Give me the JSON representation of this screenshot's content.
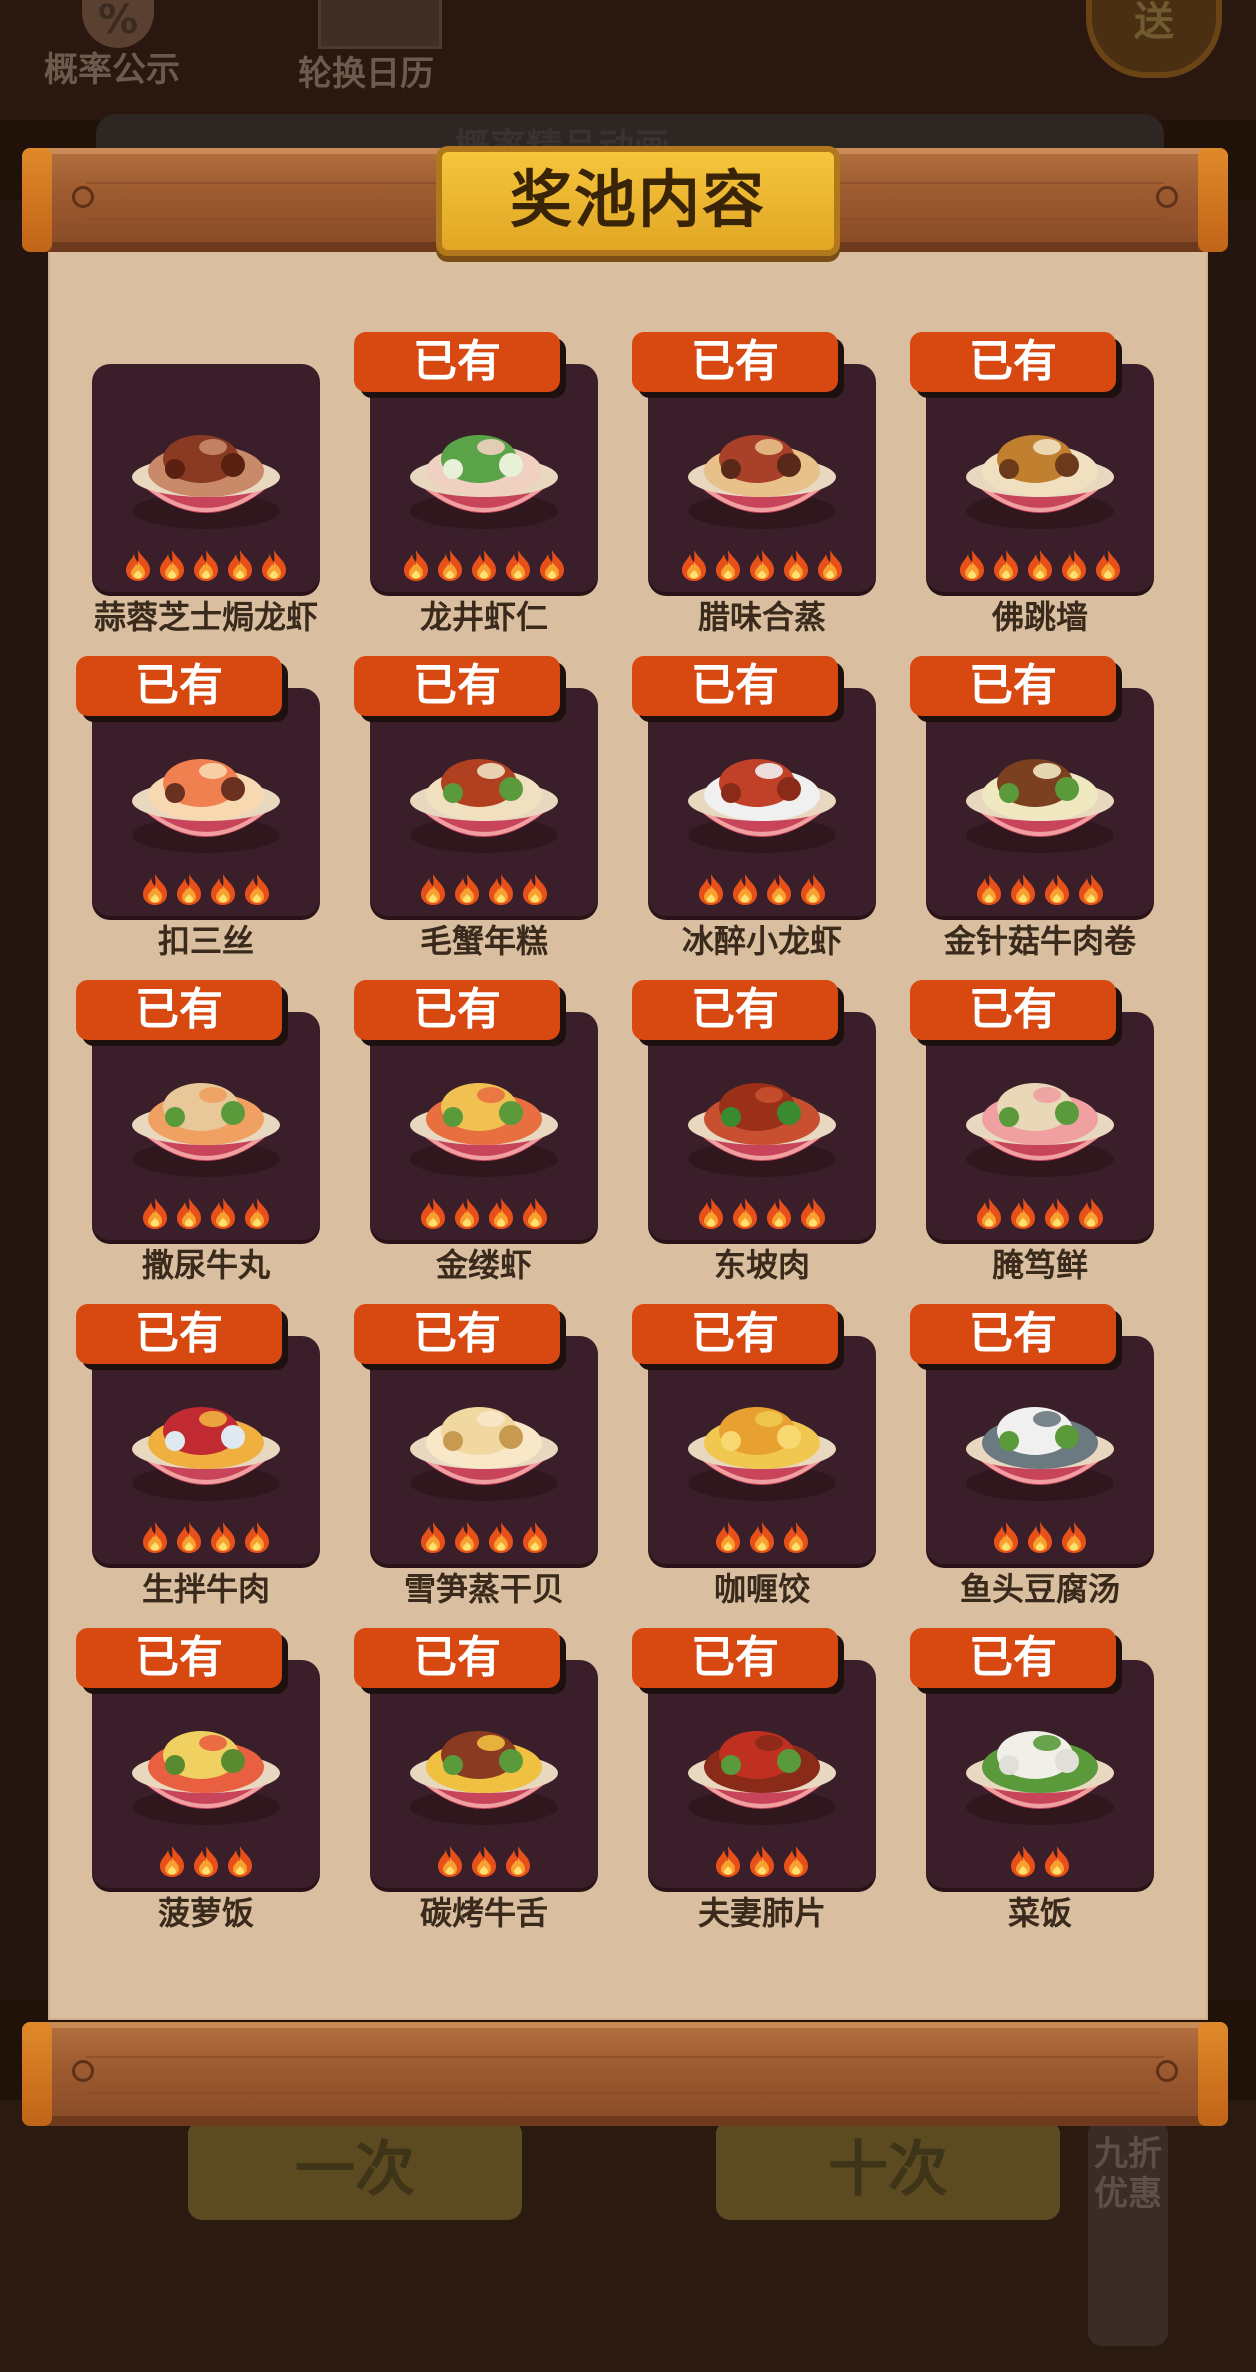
{
  "background": {
    "odds_label": "概率公示",
    "calendar_label": "轮换日历",
    "send_label": "送",
    "banner_text": "概率精品动画",
    "draw_once_label": "一次",
    "draw_ten_label": "十次",
    "discount_label": "九折优惠"
  },
  "panel": {
    "title": "奖池内容"
  },
  "colors": {
    "owned_badge": "#d84811",
    "card_bg": "#3a1f2a",
    "paper": "#d9bea0",
    "title_plate": "#f0b72f"
  },
  "dishes": [
    {
      "name": "蒜蓉芝士焗龙虾",
      "owned": "",
      "stars": 5,
      "palette": [
        "#8a3a22",
        "#c98a6a",
        "#5a2010"
      ]
    },
    {
      "name": "龙井虾仁",
      "owned": "已有",
      "stars": 5,
      "palette": [
        "#5aa348",
        "#f0d0c0",
        "#e8f0d8"
      ]
    },
    {
      "name": "腊味合蒸",
      "owned": "已有",
      "stars": 5,
      "palette": [
        "#a8402a",
        "#e8c08a",
        "#5a2818"
      ]
    },
    {
      "name": "佛跳墙",
      "owned": "已有",
      "stars": 5,
      "palette": [
        "#c08030",
        "#f0e0c0",
        "#6a3a1a"
      ]
    },
    {
      "name": "扣三丝",
      "owned": "已有",
      "stars": 4,
      "palette": [
        "#f08050",
        "#f8d8b0",
        "#6a3020"
      ]
    },
    {
      "name": "毛蟹年糕",
      "owned": "已有",
      "stars": 4,
      "palette": [
        "#b04020",
        "#f0e0c0",
        "#5a9a3a"
      ]
    },
    {
      "name": "冰醉小龙虾",
      "owned": "已有",
      "stars": 4,
      "palette": [
        "#c04028",
        "#f0f0f0",
        "#8a2a18"
      ]
    },
    {
      "name": "金针菇牛肉卷",
      "owned": "已有",
      "stars": 4,
      "palette": [
        "#7a4020",
        "#f0e8c0",
        "#5a9a3a"
      ]
    },
    {
      "name": "撒尿牛丸",
      "owned": "已有",
      "stars": 4,
      "palette": [
        "#e8c898",
        "#f0a060",
        "#5a9a3a"
      ]
    },
    {
      "name": "金缕虾",
      "owned": "已有",
      "stars": 4,
      "palette": [
        "#f0c050",
        "#e87040",
        "#5a9a3a"
      ]
    },
    {
      "name": "东坡肉",
      "owned": "已有",
      "stars": 4,
      "palette": [
        "#9a3018",
        "#c85030",
        "#3a8a30"
      ]
    },
    {
      "name": "腌笃鲜",
      "owned": "已有",
      "stars": 4,
      "palette": [
        "#e8d8b8",
        "#f0a0a0",
        "#5a9a3a"
      ]
    },
    {
      "name": "生拌牛肉",
      "owned": "已有",
      "stars": 4,
      "palette": [
        "#c02a30",
        "#f0b040",
        "#e0e8f0"
      ]
    },
    {
      "name": "雪笋蒸干贝",
      "owned": "已有",
      "stars": 4,
      "palette": [
        "#f0d8a0",
        "#f8e8c8",
        "#c89a50"
      ]
    },
    {
      "name": "咖喱饺",
      "owned": "已有",
      "stars": 3,
      "palette": [
        "#e8a030",
        "#f0c850",
        "#f8d870"
      ]
    },
    {
      "name": "鱼头豆腐汤",
      "owned": "已有",
      "stars": 3,
      "palette": [
        "#f0f0f0",
        "#6a7a80",
        "#5a9a3a"
      ]
    },
    {
      "name": "菠萝饭",
      "owned": "已有",
      "stars": 3,
      "palette": [
        "#f0d060",
        "#e86040",
        "#5a8a30"
      ]
    },
    {
      "name": "碳烤牛舌",
      "owned": "已有",
      "stars": 3,
      "palette": [
        "#8a3a20",
        "#f0c040",
        "#5a9a3a"
      ]
    },
    {
      "name": "夫妻肺片",
      "owned": "已有",
      "stars": 3,
      "palette": [
        "#c03020",
        "#8a2a18",
        "#5a9a3a"
      ]
    },
    {
      "name": "菜饭",
      "owned": "已有",
      "stars": 2,
      "palette": [
        "#f0f0e8",
        "#5a9a3a",
        "#e0e0d8"
      ]
    }
  ]
}
